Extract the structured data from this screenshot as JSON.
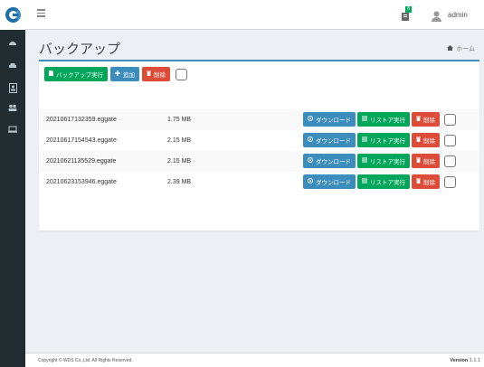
{
  "header": {
    "user_name": "admin",
    "notification_count": "8"
  },
  "page": {
    "title": "バックアップ",
    "breadcrumb_home": "ホーム"
  },
  "toolbar": {
    "backup_run": "バックアップ実行",
    "add": "追加",
    "delete": "削除"
  },
  "row_actions": {
    "download": "ダウンロード",
    "restore": "リストア実行",
    "delete": "削除"
  },
  "files": [
    {
      "name": "20210617132359.eggate",
      "size": "1.75 MB"
    },
    {
      "name": "20210617154543.eggate",
      "size": "2.15 MB"
    },
    {
      "name": "20210621135529.eggate",
      "size": "2.15 MB"
    },
    {
      "name": "20210623153946.eggate",
      "size": "2.39 MB"
    }
  ],
  "footer": {
    "copyright": "Copyright © WDS Co.,Ltd. All Rights Reserved.",
    "version_label": "Version",
    "version_number": "1.1.1"
  },
  "colors": {
    "success": "#00a65a",
    "primary": "#3c8dbc",
    "danger": "#dd4b39",
    "sidebar": "#222d32"
  },
  "icons": [
    "logo-icon",
    "dashboard-icon",
    "car-icon",
    "badge-icon",
    "users-icon",
    "monitor-icon",
    "menu-icon",
    "notification-icon",
    "user-icon",
    "home-icon",
    "file-icon",
    "plus-icon",
    "trash-icon",
    "download-icon",
    "list-icon"
  ]
}
